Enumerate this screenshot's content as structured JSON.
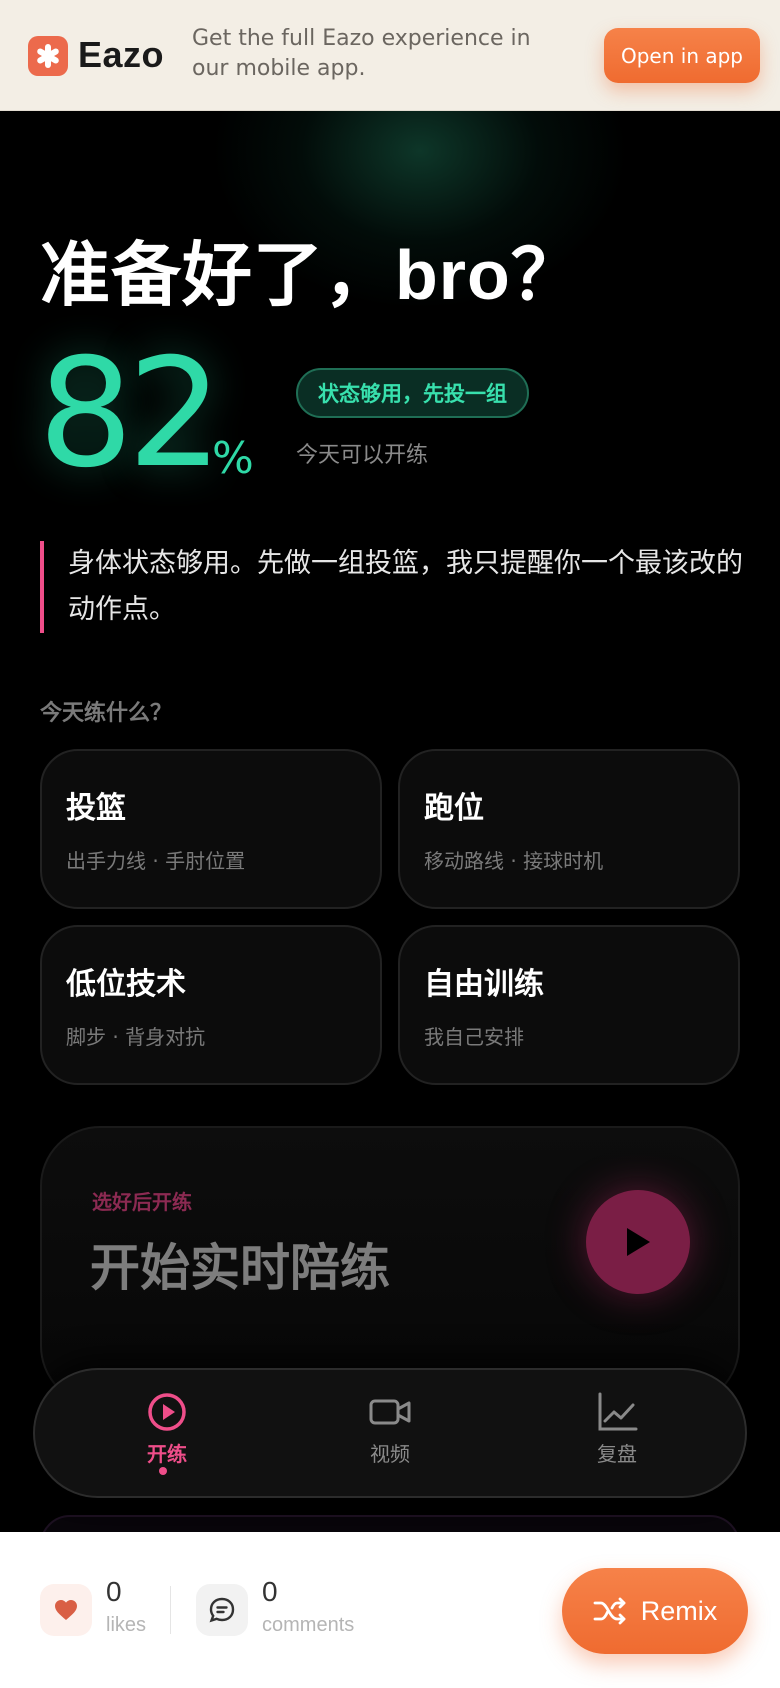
{
  "banner": {
    "brand": "Eazo",
    "message": "Get the full Eazo experience in our mobile app.",
    "open_label": "Open in app",
    "accent": "#ef6b30"
  },
  "hero": {
    "headline": "准备好了，bro？",
    "score_value": "82",
    "score_unit": "%",
    "status_pill": "状态够用，先投一组",
    "status_sub": "今天可以开练",
    "score_color": "#2fd9a7"
  },
  "quote": "身体状态够用。先做一组投篮，我只提醒你一个最该改的动作点。",
  "section_title": "今天练什么？",
  "options": [
    {
      "title": "投篮",
      "subtitle": "出手力线 · 手肘位置"
    },
    {
      "title": "跑位",
      "subtitle": "移动路线 · 接球时机"
    },
    {
      "title": "低位技术",
      "subtitle": "脚步 · 背身对抗"
    },
    {
      "title": "自由训练",
      "subtitle": "我自己安排"
    }
  ],
  "start": {
    "kicker": "选好后开练",
    "title": "开始实时陪练",
    "icon": "play-icon"
  },
  "nav": {
    "items": [
      {
        "label": "开练",
        "icon": "play-circle-icon",
        "active": true
      },
      {
        "label": "视频",
        "icon": "video-camera-icon",
        "active": false
      },
      {
        "label": "复盘",
        "icon": "line-chart-icon",
        "active": false
      }
    ],
    "active_color": "#ef4e8a"
  },
  "footer": {
    "likes_count": "0",
    "likes_label": "likes",
    "comments_count": "0",
    "comments_label": "comments",
    "remix_label": "Remix"
  }
}
